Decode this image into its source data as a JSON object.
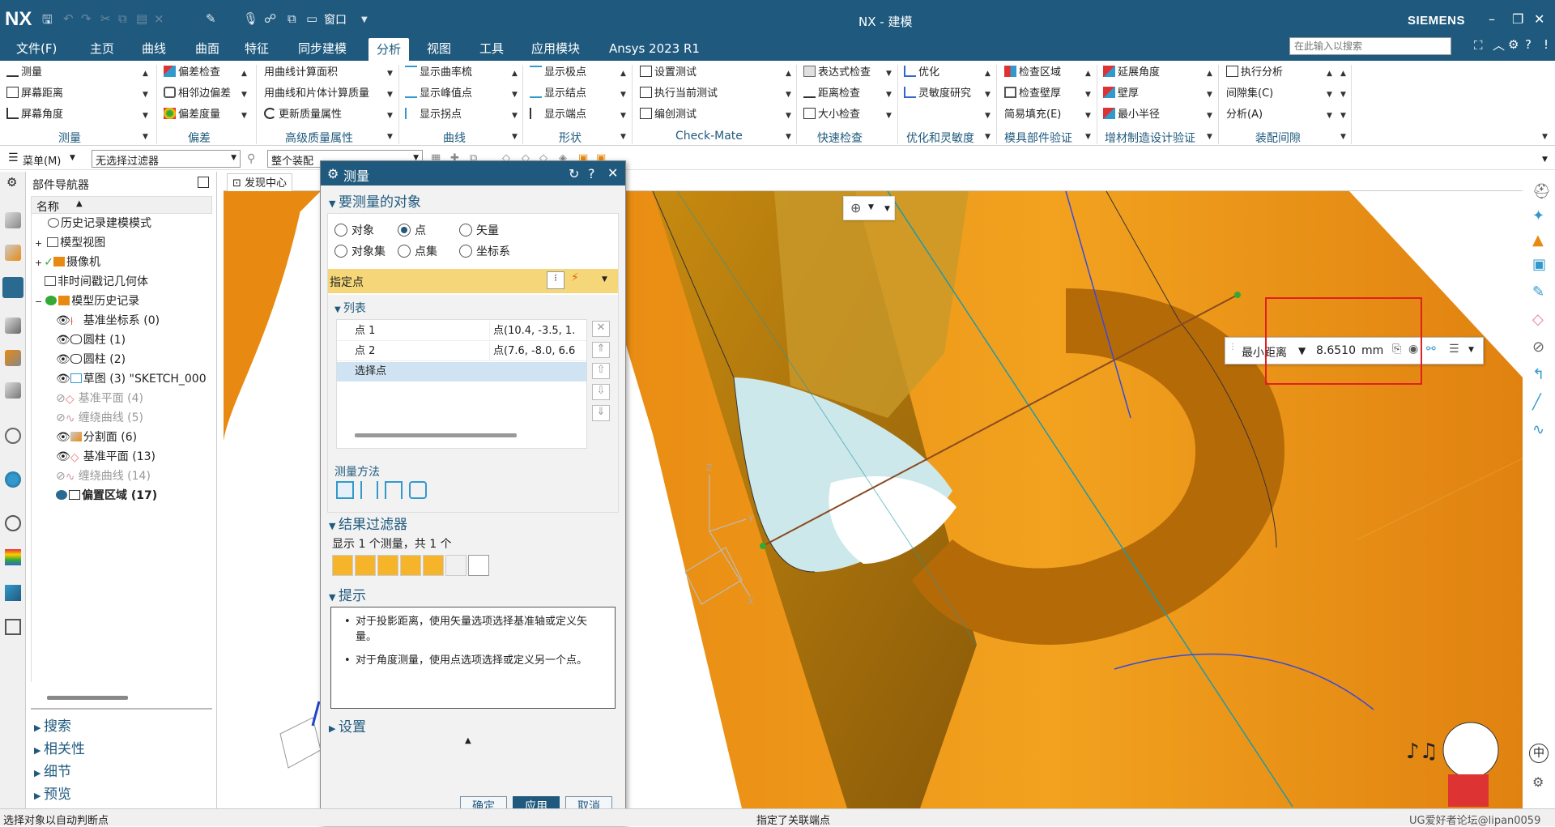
{
  "app": {
    "logo": "NX",
    "window_title": "NX - 建模",
    "brand": "SIEMENS",
    "window_menu": "窗口"
  },
  "menubar": {
    "items": [
      "文件(F)",
      "主页",
      "曲线",
      "曲面",
      "特征",
      "同步建模",
      "分析",
      "视图",
      "工具",
      "应用模块",
      "Ansys 2023 R1"
    ],
    "active": "分析",
    "search_placeholder": "在此输入以搜索"
  },
  "ribbon": {
    "groups": [
      {
        "title": "测量",
        "items": [
          "测量",
          "屏幕距离",
          "屏幕角度"
        ]
      },
      {
        "title": "偏差",
        "items": [
          "偏差检查",
          "相邻边偏差",
          "偏差度量"
        ]
      },
      {
        "title": "高级质量属性",
        "items": [
          "用曲线计算面积",
          "用曲线和片体计算质量",
          "更新质量属性"
        ]
      },
      {
        "title": "曲线",
        "items": [
          "显示曲率梳",
          "显示峰值点",
          "显示拐点"
        ]
      },
      {
        "title": "形状",
        "items": [
          "显示极点",
          "显示结点",
          "显示端点"
        ]
      },
      {
        "title": "Check-Mate",
        "items": [
          "设置测试",
          "执行当前测试",
          "编创测试"
        ]
      },
      {
        "title": "快速检查",
        "items": [
          "表达式检查",
          "距离检查",
          "大小检查"
        ]
      },
      {
        "title": "优化和灵敏度",
        "items": [
          "优化",
          "灵敏度研究"
        ]
      },
      {
        "title": "模具部件验证",
        "items": [
          "检查区域",
          "检查壁厚",
          "简易填充(E)"
        ]
      },
      {
        "title": "增材制造设计验证",
        "items": [
          "延展角度",
          "壁厚",
          "最小半径"
        ]
      },
      {
        "title": "装配间隙",
        "items": [
          "执行分析",
          "间隙集(C)",
          "分析(A)"
        ]
      }
    ]
  },
  "selection_bar": {
    "menu": "菜单(M)",
    "filter": "无选择过滤器",
    "scope": "整个装配"
  },
  "navigator": {
    "title": "部件导航器",
    "column": "名称",
    "rows": [
      {
        "label": "历史记录建模模式",
        "grey": false
      },
      {
        "label": "模型视图",
        "grey": false
      },
      {
        "label": "摄像机",
        "grey": false
      },
      {
        "label": "非时间戳记几何体",
        "grey": false
      },
      {
        "label": "模型历史记录",
        "grey": false
      },
      {
        "label": "基准坐标系 (0)",
        "grey": false
      },
      {
        "label": "圆柱 (1)",
        "grey": false
      },
      {
        "label": "圆柱 (2)",
        "grey": false
      },
      {
        "label": "草图 (3) \"SKETCH_000",
        "grey": false
      },
      {
        "label": "基准平面 (4)",
        "grey": true
      },
      {
        "label": "缠绕曲线 (5)",
        "grey": true
      },
      {
        "label": "分割面 (6)",
        "grey": false
      },
      {
        "label": "基准平面 (13)",
        "grey": false
      },
      {
        "label": "缠绕曲线 (14)",
        "grey": true
      },
      {
        "label": "偏置区域 (17)",
        "grey": false
      }
    ],
    "sections": [
      "搜索",
      "相关性",
      "细节",
      "预览"
    ]
  },
  "tabs": {
    "discovery": "发现中心"
  },
  "dialog": {
    "title": "测量",
    "objects_section": "要测量的对象",
    "radios": [
      "对象",
      "点",
      "矢量",
      "对象集",
      "点集",
      "坐标系"
    ],
    "selected_radio": "点",
    "specify_point": "指定点",
    "list_section": "列表",
    "list_rows": [
      {
        "name": "点 1",
        "value": "点(10.4, -3.5, 1."
      },
      {
        "name": "点 2",
        "value": "点(7.6, -8.0, 6.6"
      },
      {
        "name": "选择点",
        "value": ""
      }
    ],
    "method_label": "测量方法",
    "result_filter_section": "结果过滤器",
    "result_summary": "显示 1 个测量，共 1 个",
    "hint_section": "提示",
    "hints": [
      "对于投影距离，使用矢量选项选择基准轴或定义矢量。",
      "对于角度测量，使用点选项选择或定义另一个点。"
    ],
    "settings_section": "设置",
    "ok": "确定",
    "apply": "应用",
    "cancel": "取消"
  },
  "measurement": {
    "type": "最小距离",
    "value": "8.6510",
    "unit": "mm"
  },
  "status": {
    "left": "选择对象以自动判断点",
    "center": "指定了关联端点",
    "watermark": "UG爱好者论坛@lipan0059"
  },
  "colors": {
    "brand": "#1f5a7e",
    "part_orange": "#e88a12",
    "highlight": "#f5d77a"
  }
}
